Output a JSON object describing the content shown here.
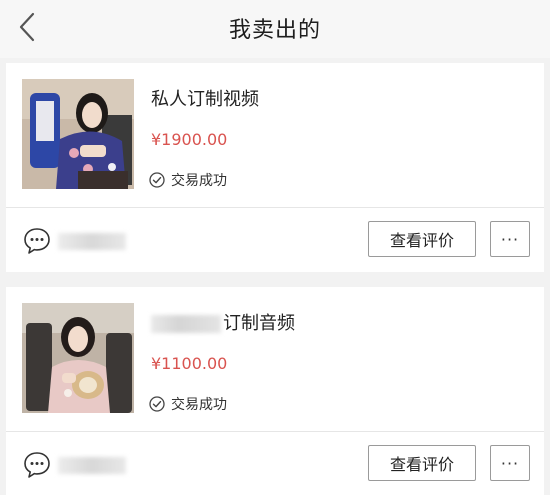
{
  "header": {
    "title": "我卖出的",
    "back_icon": "chevron-left-icon"
  },
  "orders": [
    {
      "title": "私人订制视频",
      "price": "¥1900.00",
      "status": "交易成功",
      "review_label": "查看评价",
      "more_label": "···"
    },
    {
      "title": "订制音频",
      "price": "¥1100.00",
      "status": "交易成功",
      "review_label": "查看评价",
      "more_label": "···"
    }
  ],
  "colors": {
    "price": "#d9534f",
    "background": "#f2f2f2",
    "card": "#ffffff"
  }
}
